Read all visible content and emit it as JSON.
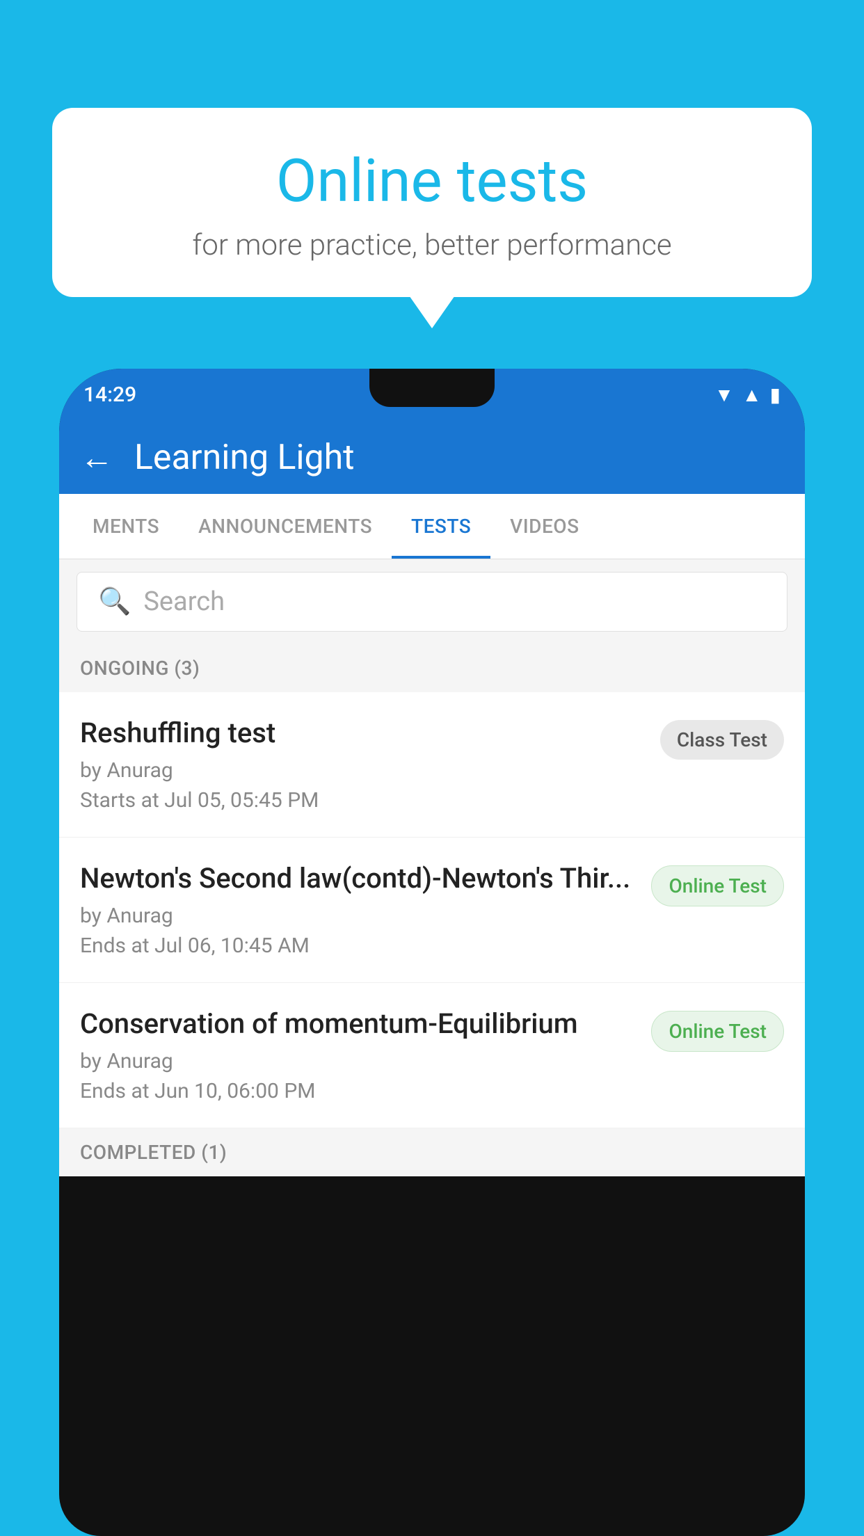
{
  "background": {
    "color": "#1ab8e8"
  },
  "bubble": {
    "title": "Online tests",
    "subtitle": "for more practice, better performance"
  },
  "phone": {
    "statusBar": {
      "time": "14:29"
    },
    "appBar": {
      "title": "Learning Light",
      "backLabel": "←"
    },
    "tabs": [
      {
        "label": "MENTS",
        "active": false
      },
      {
        "label": "ANNOUNCEMENTS",
        "active": false
      },
      {
        "label": "TESTS",
        "active": true
      },
      {
        "label": "VIDEOS",
        "active": false
      }
    ],
    "search": {
      "placeholder": "Search"
    },
    "ongoingSection": {
      "label": "ONGOING (3)"
    },
    "tests": [
      {
        "name": "Reshuffling test",
        "author": "by Anurag",
        "time": "Starts at  Jul 05, 05:45 PM",
        "badge": "Class Test",
        "badgeType": "class"
      },
      {
        "name": "Newton's Second law(contd)-Newton's Thir...",
        "author": "by Anurag",
        "time": "Ends at  Jul 06, 10:45 AM",
        "badge": "Online Test",
        "badgeType": "online"
      },
      {
        "name": "Conservation of momentum-Equilibrium",
        "author": "by Anurag",
        "time": "Ends at  Jun 10, 06:00 PM",
        "badge": "Online Test",
        "badgeType": "online"
      }
    ],
    "completedSection": {
      "label": "COMPLETED (1)"
    }
  }
}
